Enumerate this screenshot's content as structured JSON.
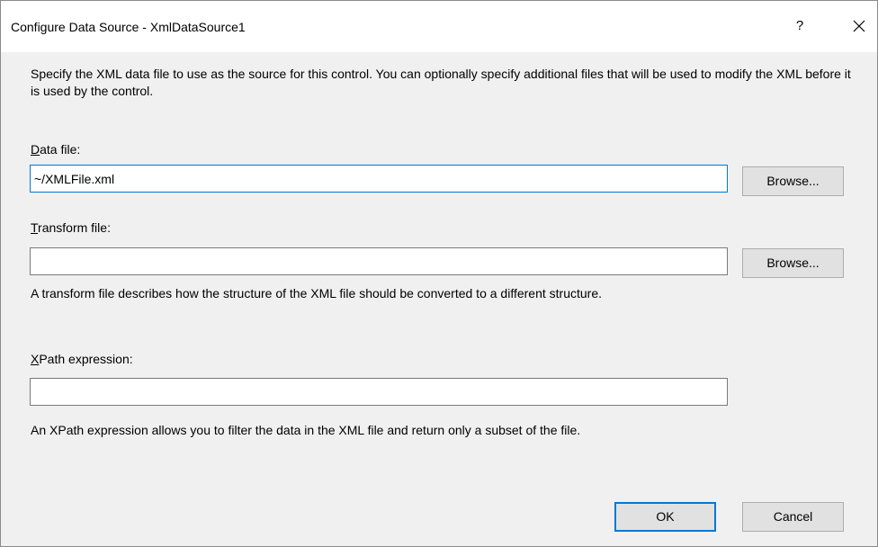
{
  "window": {
    "title": "Configure Data Source - XmlDataSource1",
    "help_glyph": "?",
    "close_icon": "close-icon"
  },
  "description": "Specify the XML data file to use as the source for this control. You can optionally specify additional files that will be used to modify the XML before it is used by the control.",
  "data_file": {
    "label_mnemonic": "D",
    "label_rest": "ata file:",
    "value": "~/XMLFile.xml",
    "browse_label": "Browse..."
  },
  "transform_file": {
    "label_mnemonic": "T",
    "label_rest": "ransform file:",
    "value": "",
    "browse_label": "Browse...",
    "hint": "A transform file describes how the structure of the XML file should be converted to a different structure."
  },
  "xpath": {
    "label_mnemonic": "X",
    "label_rest": "Path expression:",
    "value": "",
    "hint": "An XPath expression allows you to filter the data in the XML file and return only a subset of the file."
  },
  "buttons": {
    "ok": "OK",
    "cancel": "Cancel"
  },
  "colors": {
    "accent": "#0078d7",
    "dialog_background": "#f0f0f0",
    "button_background": "#e1e1e1"
  }
}
